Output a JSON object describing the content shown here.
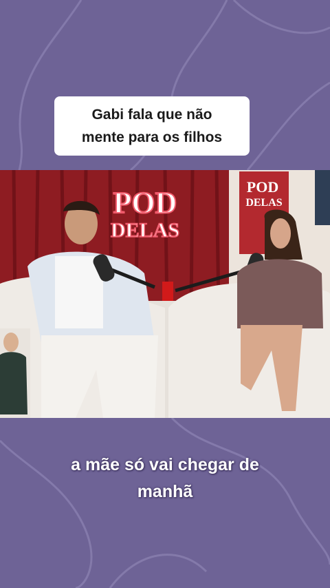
{
  "title": "Gabi fala que não\nmente para os filhos",
  "video": {
    "logo_top": "POD",
    "logo_bottom": "DELAS",
    "frame_logo_top": "POD",
    "frame_logo_bottom": "DELAS"
  },
  "subtitle": "a mãe só vai chegar de\nmanhã",
  "colors": {
    "background": "#6e6396",
    "curtain": "#8b1f25",
    "caption_text": "#ffffff"
  }
}
